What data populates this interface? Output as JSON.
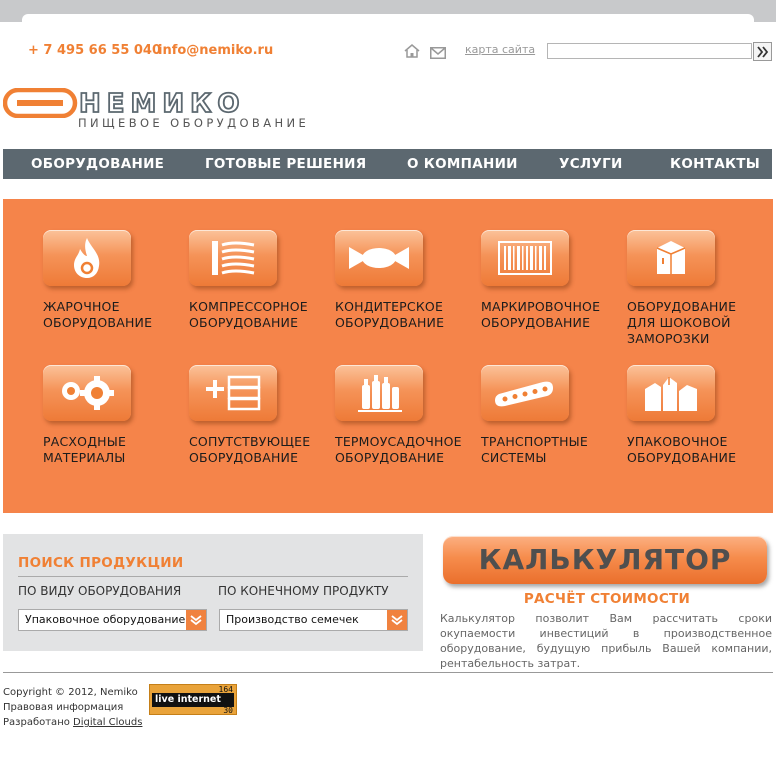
{
  "header": {
    "phone": "+ 7 495 66 55 040",
    "email": "info@nemiko.ru",
    "sitemap_label": "карта сайта",
    "search_value": ""
  },
  "logo": {
    "name": "НЕМИКО",
    "tagline": "ПИЩЕВОЕ ОБОРУДОВАНИЕ"
  },
  "nav": {
    "items": [
      {
        "label": "ОБОРУДОВАНИЕ"
      },
      {
        "label": "ГОТОВЫЕ РЕШЕНИЯ"
      },
      {
        "label": "О КОМПАНИИ"
      },
      {
        "label": "УСЛУГИ"
      },
      {
        "label": "КОНТАКТЫ"
      }
    ]
  },
  "categories": [
    {
      "label": "ЖАРОЧНОЕ\nОБОРУДОВАНИЕ",
      "icon": "flame-icon"
    },
    {
      "label": "КОМПРЕССОРНОЕ\nОБОРУДОВАНИЕ",
      "icon": "compressor-icon"
    },
    {
      "label": "КОНДИТЕРСКОЕ\nОБОРУДОВАНИЕ",
      "icon": "candy-icon"
    },
    {
      "label": "МАРКИРОВОЧНОЕ\nОБОРУДОВАНИЕ",
      "icon": "barcode-icon"
    },
    {
      "label": "ОБОРУДОВАНИЕ\nДЛЯ ШОКОВОЙ\nЗАМОРОЗКИ",
      "icon": "freezer-icon"
    },
    {
      "label": "РАСХОДНЫЕ\nМАТЕРИАЛЫ",
      "icon": "gears-icon"
    },
    {
      "label": "СОПУТСТВУЮЩЕЕ\nОБОРУДОВАНИЕ",
      "icon": "plus-list-icon"
    },
    {
      "label": "ТЕРМОУСАДОЧНОЕ\nОБОРУДОВАНИЕ",
      "icon": "bottles-icon"
    },
    {
      "label": "ТРАНСПОРТНЫЕ\nСИСТЕМЫ",
      "icon": "conveyor-icon"
    },
    {
      "label": "УПАКОВОЧНОЕ\nОБОРУДОВАНИЕ",
      "icon": "packages-icon"
    }
  ],
  "search_panel": {
    "title": "ПОИСК ПРОДУКЦИИ",
    "by_type_label": "ПО ВИДУ ОБОРУДОВАНИЯ",
    "by_product_label": "ПО КОНЕЧНОМУ ПРОДУКТУ",
    "by_type_value": "Упаковочное оборудование",
    "by_product_value": "Производство семечек"
  },
  "calculator": {
    "button_label": "КАЛЬКУЛЯТОР",
    "subtitle": "РАСЧЁТ СТОИМОСТИ",
    "description": "Калькулятор позволит Вам рассчитать сроки окупаемости инвестиций в производственное оборудование, будущую прибыль Вашей компании, рентабельность затрат."
  },
  "footer": {
    "copyright": "Copyright © 2012, Nemiko",
    "legal": "Правовая информация",
    "developed_prefix": "Разработано",
    "developer": "Digital Clouds",
    "counter_brand": "live internet",
    "counter_top": "164",
    "counter_bottom": "30"
  },
  "colors": {
    "accent": "#f08034",
    "panel": "#f5844a",
    "nav": "#5c6870"
  }
}
